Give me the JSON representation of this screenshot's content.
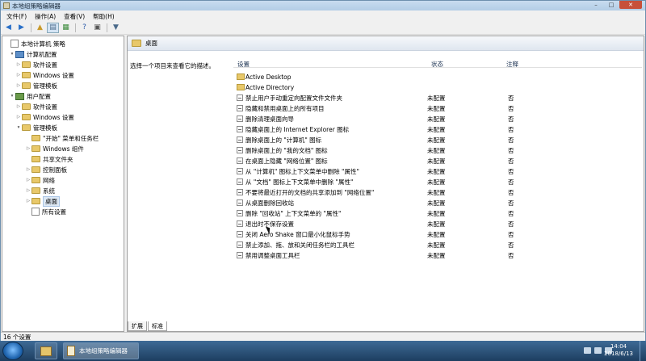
{
  "window": {
    "title": "本地组策略编辑器",
    "controls": {
      "minimize": "–",
      "maximize": "□",
      "close": "✕"
    }
  },
  "menubar": [
    "文件(F)",
    "操作(A)",
    "查看(V)",
    "帮助(H)"
  ],
  "toolbar": [
    "back-arrow-icon",
    "forward-arrow-icon",
    "up-folder-icon",
    "show-tree-icon",
    "export-list-icon",
    "properties-icon",
    "help-icon",
    "filter-icon"
  ],
  "tree": [
    {
      "label": "本地计算机 策略",
      "level": 0,
      "icon": "policy-icon",
      "exp": ""
    },
    {
      "label": "计算机配置",
      "level": 1,
      "icon": "computer-icon",
      "exp": "▾"
    },
    {
      "label": "软件设置",
      "level": 2,
      "icon": "folder-icon",
      "exp": "▷"
    },
    {
      "label": "Windows 设置",
      "level": 2,
      "icon": "folder-icon",
      "exp": "▷"
    },
    {
      "label": "管理模板",
      "level": 2,
      "icon": "folder-icon",
      "exp": "▷"
    },
    {
      "label": "用户配置",
      "level": 1,
      "icon": "user-icon",
      "exp": "▾"
    },
    {
      "label": "软件设置",
      "level": 2,
      "icon": "folder-icon",
      "exp": "▷"
    },
    {
      "label": "Windows 设置",
      "level": 2,
      "icon": "folder-icon",
      "exp": "▷"
    },
    {
      "label": "管理模板",
      "level": 2,
      "icon": "folder-icon",
      "exp": "▾"
    },
    {
      "label": "\"开始\" 菜单和任务栏",
      "level": 3,
      "icon": "folder-icon",
      "exp": ""
    },
    {
      "label": "Windows 组件",
      "level": 3,
      "icon": "folder-icon",
      "exp": "▷"
    },
    {
      "label": "共享文件夹",
      "level": 3,
      "icon": "folder-icon",
      "exp": ""
    },
    {
      "label": "控制面板",
      "level": 3,
      "icon": "folder-icon",
      "exp": "▷"
    },
    {
      "label": "网络",
      "level": 3,
      "icon": "folder-icon",
      "exp": "▷"
    },
    {
      "label": "系统",
      "level": 3,
      "icon": "folder-icon",
      "exp": "▷"
    },
    {
      "label": "桌面",
      "level": 3,
      "icon": "folder-icon",
      "exp": "▷",
      "selected": true
    },
    {
      "label": "所有设置",
      "level": 3,
      "icon": "settings-icon",
      "exp": ""
    }
  ],
  "right": {
    "header": "桌面",
    "description": "选择一个项目来查看它的描述。",
    "columns": {
      "setting": "设置",
      "state": "状态",
      "comment": "注释"
    },
    "rows": [
      {
        "name": "Active Desktop",
        "type": "folder",
        "state": "",
        "comment": ""
      },
      {
        "name": "Active Directory",
        "type": "folder",
        "state": "",
        "comment": ""
      },
      {
        "name": "禁止用户手动重定向配置文件文件夹",
        "type": "policy",
        "state": "未配置",
        "comment": "否"
      },
      {
        "name": "隐藏和禁用桌面上的所有项目",
        "type": "policy",
        "state": "未配置",
        "comment": "否"
      },
      {
        "name": "删除清理桌面向导",
        "type": "policy",
        "state": "未配置",
        "comment": "否"
      },
      {
        "name": "隐藏桌面上的 Internet Explorer 图标",
        "type": "policy",
        "state": "未配置",
        "comment": "否"
      },
      {
        "name": "删除桌面上的 \"计算机\" 图标",
        "type": "policy",
        "state": "未配置",
        "comment": "否"
      },
      {
        "name": "删除桌面上的 \"我的文档\" 图标",
        "type": "policy",
        "state": "未配置",
        "comment": "否"
      },
      {
        "name": "在桌面上隐藏 \"网络位置\" 图标",
        "type": "policy",
        "state": "未配置",
        "comment": "否"
      },
      {
        "name": "从 \"计算机\" 图标上下文菜单中删除 \"属性\"",
        "type": "policy",
        "state": "未配置",
        "comment": "否"
      },
      {
        "name": "从 \"文档\" 图标上下文菜单中删除 \"属性\"",
        "type": "policy",
        "state": "未配置",
        "comment": "否"
      },
      {
        "name": "不要将最近打开的文档的共享添加到 \"网络位置\"",
        "type": "policy",
        "state": "未配置",
        "comment": "否"
      },
      {
        "name": "从桌面删除回收站",
        "type": "policy",
        "state": "未配置",
        "comment": "否"
      },
      {
        "name": "删除 \"回收站\" 上下文菜单的 \"属性\"",
        "type": "policy",
        "state": "未配置",
        "comment": "否"
      },
      {
        "name": "退出时不保存设置",
        "type": "policy",
        "state": "未配置",
        "comment": "否"
      },
      {
        "name": "关闭 Aero Shake 窗口最小化鼠标手势",
        "type": "policy",
        "state": "未配置",
        "comment": "否"
      },
      {
        "name": "禁止添加、拖、放和关闭任务栏的工具栏",
        "type": "policy",
        "state": "未配置",
        "comment": "否"
      },
      {
        "name": "禁用调整桌面工具栏",
        "type": "policy",
        "state": "未配置",
        "comment": "否"
      }
    ]
  },
  "tabs": [
    "扩展",
    "标准"
  ],
  "status": "16 个设置",
  "taskbar": {
    "app_label": "本地组策略编辑器",
    "time": "14:04",
    "date": "2018/6/13"
  }
}
